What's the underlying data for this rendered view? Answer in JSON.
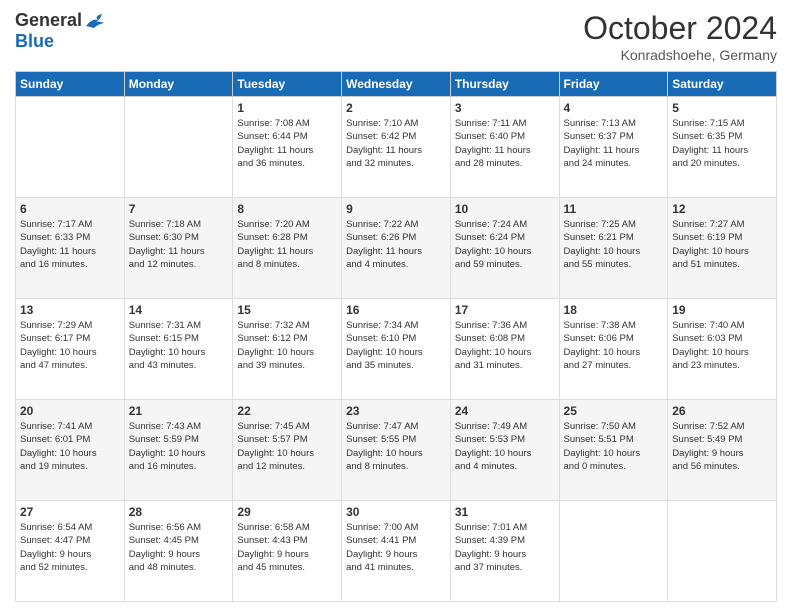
{
  "logo": {
    "general": "General",
    "blue": "Blue"
  },
  "header": {
    "month": "October 2024",
    "location": "Konradshoehe, Germany"
  },
  "days_of_week": [
    "Sunday",
    "Monday",
    "Tuesday",
    "Wednesday",
    "Thursday",
    "Friday",
    "Saturday"
  ],
  "weeks": [
    [
      {
        "day": "",
        "info": ""
      },
      {
        "day": "",
        "info": ""
      },
      {
        "day": "1",
        "info": "Sunrise: 7:08 AM\nSunset: 6:44 PM\nDaylight: 11 hours\nand 36 minutes."
      },
      {
        "day": "2",
        "info": "Sunrise: 7:10 AM\nSunset: 6:42 PM\nDaylight: 11 hours\nand 32 minutes."
      },
      {
        "day": "3",
        "info": "Sunrise: 7:11 AM\nSunset: 6:40 PM\nDaylight: 11 hours\nand 28 minutes."
      },
      {
        "day": "4",
        "info": "Sunrise: 7:13 AM\nSunset: 6:37 PM\nDaylight: 11 hours\nand 24 minutes."
      },
      {
        "day": "5",
        "info": "Sunrise: 7:15 AM\nSunset: 6:35 PM\nDaylight: 11 hours\nand 20 minutes."
      }
    ],
    [
      {
        "day": "6",
        "info": "Sunrise: 7:17 AM\nSunset: 6:33 PM\nDaylight: 11 hours\nand 16 minutes."
      },
      {
        "day": "7",
        "info": "Sunrise: 7:18 AM\nSunset: 6:30 PM\nDaylight: 11 hours\nand 12 minutes."
      },
      {
        "day": "8",
        "info": "Sunrise: 7:20 AM\nSunset: 6:28 PM\nDaylight: 11 hours\nand 8 minutes."
      },
      {
        "day": "9",
        "info": "Sunrise: 7:22 AM\nSunset: 6:26 PM\nDaylight: 11 hours\nand 4 minutes."
      },
      {
        "day": "10",
        "info": "Sunrise: 7:24 AM\nSunset: 6:24 PM\nDaylight: 10 hours\nand 59 minutes."
      },
      {
        "day": "11",
        "info": "Sunrise: 7:25 AM\nSunset: 6:21 PM\nDaylight: 10 hours\nand 55 minutes."
      },
      {
        "day": "12",
        "info": "Sunrise: 7:27 AM\nSunset: 6:19 PM\nDaylight: 10 hours\nand 51 minutes."
      }
    ],
    [
      {
        "day": "13",
        "info": "Sunrise: 7:29 AM\nSunset: 6:17 PM\nDaylight: 10 hours\nand 47 minutes."
      },
      {
        "day": "14",
        "info": "Sunrise: 7:31 AM\nSunset: 6:15 PM\nDaylight: 10 hours\nand 43 minutes."
      },
      {
        "day": "15",
        "info": "Sunrise: 7:32 AM\nSunset: 6:12 PM\nDaylight: 10 hours\nand 39 minutes."
      },
      {
        "day": "16",
        "info": "Sunrise: 7:34 AM\nSunset: 6:10 PM\nDaylight: 10 hours\nand 35 minutes."
      },
      {
        "day": "17",
        "info": "Sunrise: 7:36 AM\nSunset: 6:08 PM\nDaylight: 10 hours\nand 31 minutes."
      },
      {
        "day": "18",
        "info": "Sunrise: 7:38 AM\nSunset: 6:06 PM\nDaylight: 10 hours\nand 27 minutes."
      },
      {
        "day": "19",
        "info": "Sunrise: 7:40 AM\nSunset: 6:03 PM\nDaylight: 10 hours\nand 23 minutes."
      }
    ],
    [
      {
        "day": "20",
        "info": "Sunrise: 7:41 AM\nSunset: 6:01 PM\nDaylight: 10 hours\nand 19 minutes."
      },
      {
        "day": "21",
        "info": "Sunrise: 7:43 AM\nSunset: 5:59 PM\nDaylight: 10 hours\nand 16 minutes."
      },
      {
        "day": "22",
        "info": "Sunrise: 7:45 AM\nSunset: 5:57 PM\nDaylight: 10 hours\nand 12 minutes."
      },
      {
        "day": "23",
        "info": "Sunrise: 7:47 AM\nSunset: 5:55 PM\nDaylight: 10 hours\nand 8 minutes."
      },
      {
        "day": "24",
        "info": "Sunrise: 7:49 AM\nSunset: 5:53 PM\nDaylight: 10 hours\nand 4 minutes."
      },
      {
        "day": "25",
        "info": "Sunrise: 7:50 AM\nSunset: 5:51 PM\nDaylight: 10 hours\nand 0 minutes."
      },
      {
        "day": "26",
        "info": "Sunrise: 7:52 AM\nSunset: 5:49 PM\nDaylight: 9 hours\nand 56 minutes."
      }
    ],
    [
      {
        "day": "27",
        "info": "Sunrise: 6:54 AM\nSunset: 4:47 PM\nDaylight: 9 hours\nand 52 minutes."
      },
      {
        "day": "28",
        "info": "Sunrise: 6:56 AM\nSunset: 4:45 PM\nDaylight: 9 hours\nand 48 minutes."
      },
      {
        "day": "29",
        "info": "Sunrise: 6:58 AM\nSunset: 4:43 PM\nDaylight: 9 hours\nand 45 minutes."
      },
      {
        "day": "30",
        "info": "Sunrise: 7:00 AM\nSunset: 4:41 PM\nDaylight: 9 hours\nand 41 minutes."
      },
      {
        "day": "31",
        "info": "Sunrise: 7:01 AM\nSunset: 4:39 PM\nDaylight: 9 hours\nand 37 minutes."
      },
      {
        "day": "",
        "info": ""
      },
      {
        "day": "",
        "info": ""
      }
    ]
  ]
}
